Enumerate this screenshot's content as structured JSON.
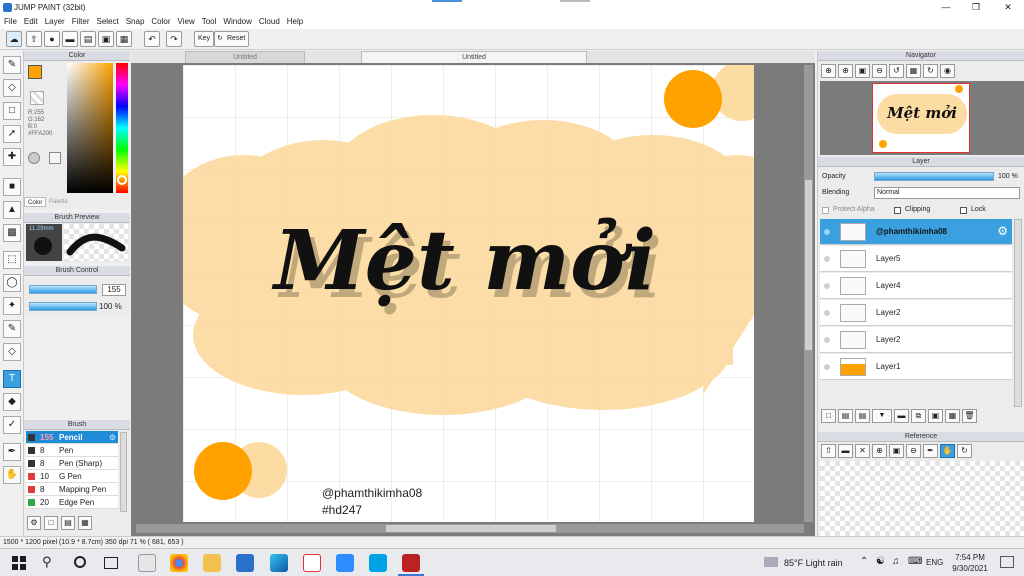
{
  "window": {
    "title": "JUMP PAINT (32bit)"
  },
  "menu": [
    "File",
    "Edit",
    "Layer",
    "Filter",
    "Select",
    "Snap",
    "Color",
    "View",
    "Tool",
    "Window",
    "Cloud",
    "Help"
  ],
  "toolbar": {
    "key_label": "Key",
    "reset_label": "Reset"
  },
  "color_panel": {
    "title": "Color",
    "r": "R:255",
    "g": "G:162",
    "b": "B:0",
    "hex": "#FFA200",
    "tab_color": "Color",
    "tab_palette": "Palette",
    "current_color": "#ffa200"
  },
  "brush_preview": {
    "title": "Brush Preview",
    "size": "11.29mm"
  },
  "brush_control": {
    "title": "Brush Control",
    "size_value": "155",
    "opacity_value": "100 %",
    "size_fraction": 0.72,
    "opacity_fraction": 1.0
  },
  "brush_list": {
    "title": "Brush",
    "items": [
      {
        "size": "155",
        "name": "Pencil",
        "color": "#333333",
        "selected": true
      },
      {
        "size": "8",
        "name": "Pen",
        "color": "#333333"
      },
      {
        "size": "8",
        "name": "Pen (Sharp)",
        "color": "#333333"
      },
      {
        "size": "10",
        "name": "G Pen",
        "color": "#e23b3b"
      },
      {
        "size": "8",
        "name": "Mapping Pen",
        "color": "#e23b3b"
      },
      {
        "size": "20",
        "name": "Edge Pen",
        "color": "#2ea84a"
      }
    ]
  },
  "doc_tabs": [
    "Untitled",
    "Untitled"
  ],
  "canvas": {
    "title_text": "Mệt mởi",
    "credit_handle": "@phamthikimha08",
    "credit_tag": "#hd247",
    "accent": "#ffa200",
    "cloud_color": "#fddca3"
  },
  "status": {
    "text": "1500 * 1200 pixel   (10.9 * 8.7cm)   350 dpi   71 %   ( 681, 653 )"
  },
  "navigator": {
    "title": "Navigator"
  },
  "layer_panel": {
    "title": "Layer",
    "opacity_label": "Opacity",
    "opacity_value": "100 %",
    "blending_label": "Blending",
    "blending_value": "Normal",
    "protect_alpha": "Protect Alpha",
    "clipping": "Clipping",
    "lock": "Lock",
    "layers": [
      {
        "name": "@phamthikimha08",
        "selected": true
      },
      {
        "name": "Layer5"
      },
      {
        "name": "Layer4"
      },
      {
        "name": "Layer2"
      },
      {
        "name": "Layer2"
      },
      {
        "name": "Layer1"
      }
    ]
  },
  "reference": {
    "title": "Reference"
  },
  "taskbar": {
    "weather": "85°F  Light rain",
    "lang": "ENG",
    "time": "7:54 PM",
    "date": "9/30/2021"
  }
}
